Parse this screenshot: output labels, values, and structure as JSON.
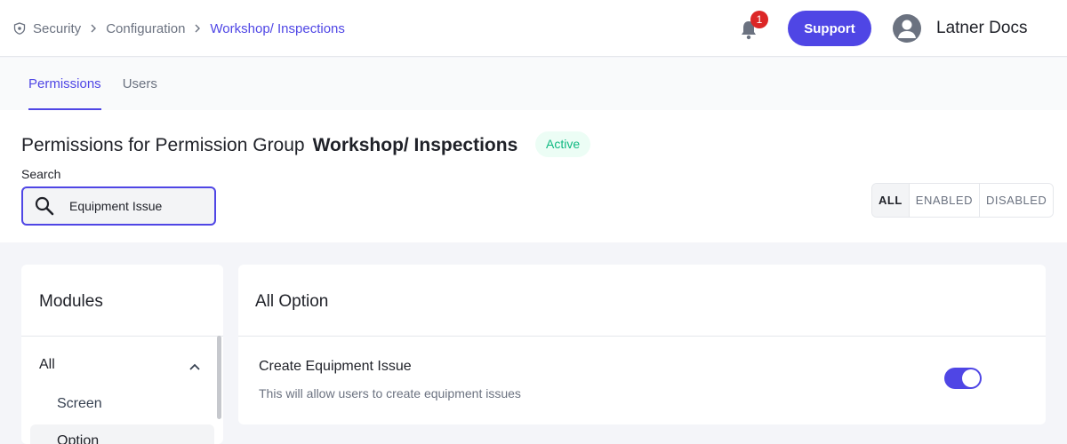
{
  "breadcrumb": {
    "items": [
      "Security",
      "Configuration",
      "Workshop/ Inspections"
    ]
  },
  "header": {
    "notification_count": "1",
    "support_label": "Support",
    "user_name": "Latner Docs"
  },
  "tabs": [
    {
      "label": "Permissions",
      "active": true
    },
    {
      "label": "Users",
      "active": false
    }
  ],
  "page": {
    "title_prefix": "Permissions for Permission Group",
    "title_group": "Workshop/ Inspections",
    "status": "Active"
  },
  "search": {
    "label": "Search",
    "value": "Equipment Issue"
  },
  "filters": [
    {
      "label": "ALL",
      "active": true
    },
    {
      "label": "ENABLED",
      "active": false
    },
    {
      "label": "DISABLED",
      "active": false
    }
  ],
  "modules": {
    "title": "Modules",
    "items": [
      {
        "label": "All",
        "expanded": true
      },
      {
        "label": "Screen"
      },
      {
        "label": "Option",
        "selected": true
      }
    ]
  },
  "options": {
    "title": "All Option",
    "items": [
      {
        "title": "Create Equipment Issue",
        "description": "This will allow users to create equipment issues",
        "enabled": true
      }
    ]
  },
  "colors": {
    "accent": "#4f46e5",
    "badge_red": "#dc2626",
    "active_green": "#10b981"
  },
  "icons": {
    "breadcrumb_root": "shield-icon",
    "separator": "chevron-right-icon",
    "notification": "bell-icon",
    "avatar": "user-avatar-icon",
    "search": "search-icon",
    "collapse": "chevron-up-icon"
  }
}
